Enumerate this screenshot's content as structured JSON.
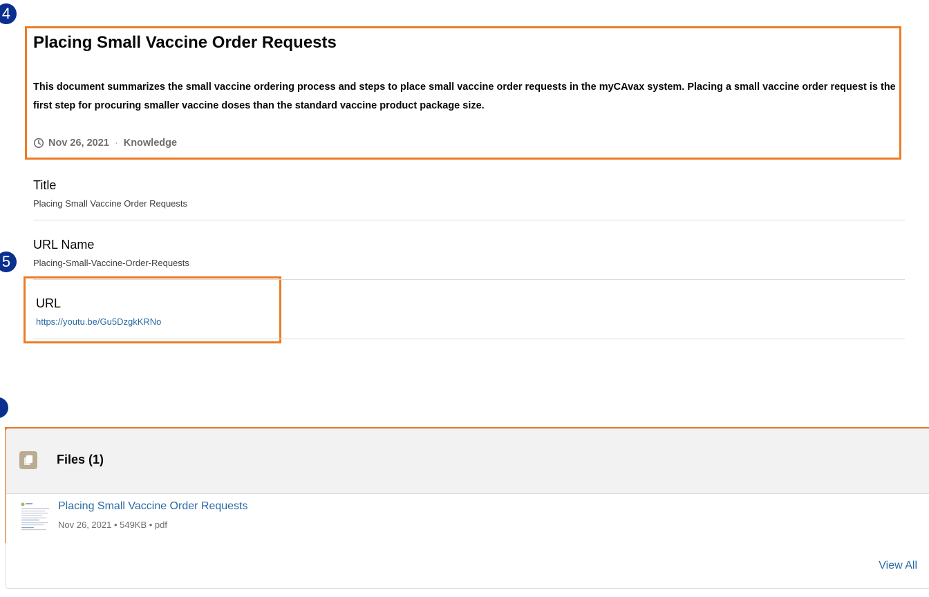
{
  "annotations": {
    "badge_top": "4",
    "badge_mid": "5"
  },
  "article": {
    "title": "Placing Small Vaccine Order Requests",
    "summary": "This document summarizes the small vaccine ordering process and steps to place small vaccine order requests in the myCAvax system. Placing a small vaccine order request is the first step for procuring smaller vaccine doses than the standard vaccine product package size.",
    "date": "Nov 26, 2021",
    "separator": "·",
    "type": "Knowledge"
  },
  "fields": {
    "title": {
      "label": "Title",
      "value": "Placing Small Vaccine Order Requests"
    },
    "url_name": {
      "label": "URL Name",
      "value": "Placing-Small-Vaccine-Order-Requests"
    },
    "url": {
      "label": "URL",
      "value": "https://youtu.be/Gu5DzgkKRNo"
    }
  },
  "files": {
    "header": "Files (1)",
    "items": [
      {
        "name": "Placing Small Vaccine Order Requests",
        "meta": "Nov 26, 2021 • 549KB • pdf"
      }
    ],
    "view_all": "View All"
  },
  "colors": {
    "highlight": "#ec7c24",
    "badge": "#0b2f8f",
    "link": "#2a6aa6",
    "files_icon": "#baac93"
  },
  "icons": {
    "meta": "clock-icon",
    "files_header": "files-icon",
    "file": "pdf-thumbnail-icon"
  }
}
